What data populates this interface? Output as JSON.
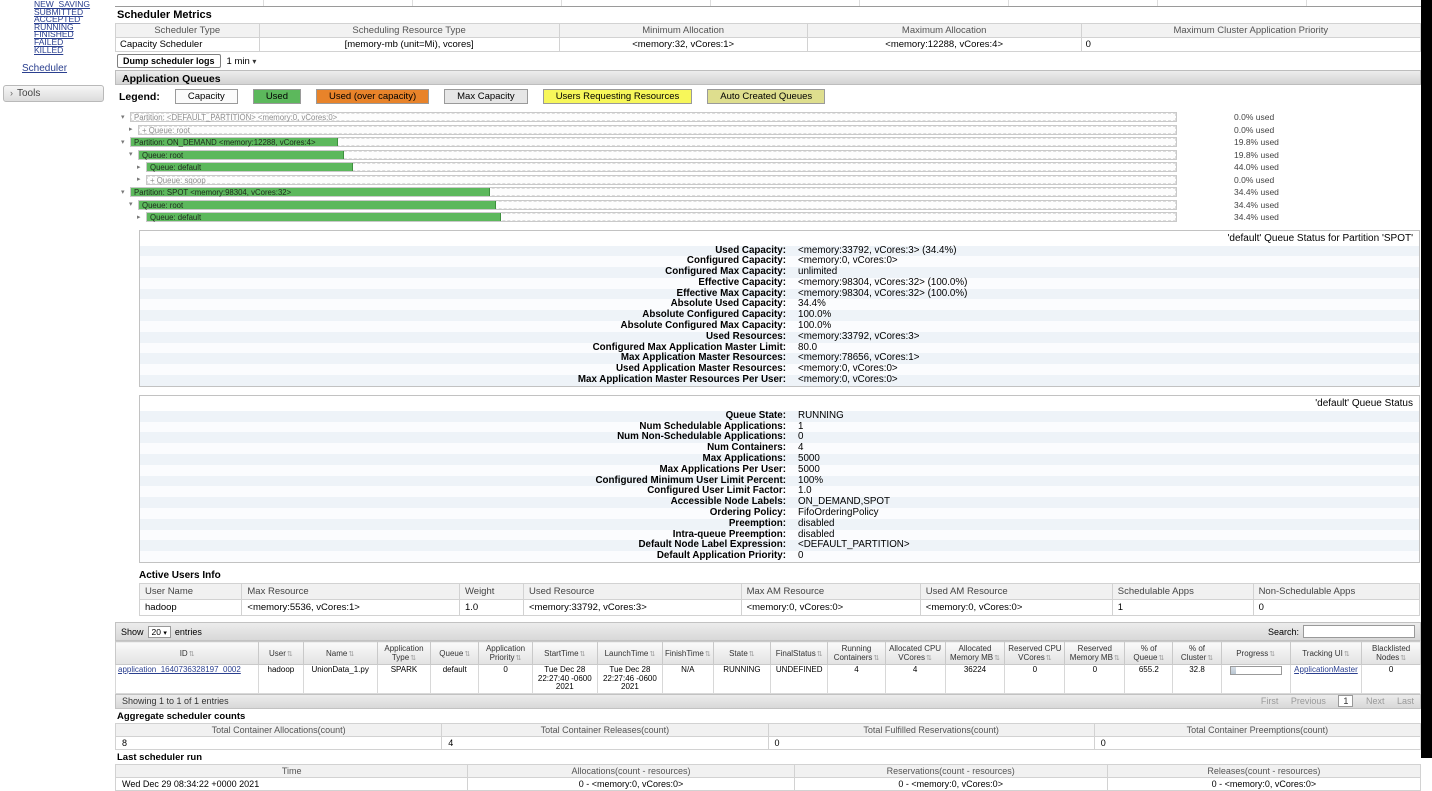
{
  "colors": {
    "used": "#5cb85c",
    "used_border": "#3e8f3e",
    "over_capacity": "#e8832a",
    "max_capacity": "#e6e6e6",
    "capacity": "#fbfbfb",
    "users_requesting": "#f7f75a",
    "auto_created": "#dede8e"
  },
  "sidebar": {
    "app_states": [
      "NEW_SAVING",
      "SUBMITTED",
      "ACCEPTED",
      "RUNNING",
      "FINISHED",
      "FAILED",
      "KILLED"
    ],
    "scheduler": "Scheduler",
    "tools": "Tools",
    "tools_chevron": "›"
  },
  "scheduler_metrics": {
    "title": "Scheduler Metrics",
    "headers": [
      "Scheduler Type",
      "Scheduling Resource Type",
      "Minimum Allocation",
      "Maximum Allocation",
      "Maximum Cluster Application Priority"
    ],
    "row": [
      "Capacity Scheduler",
      "[memory-mb (unit=Mi), vcores]",
      "<memory:32, vCores:1>",
      "<memory:12288, vCores:4>",
      "0"
    ]
  },
  "dump": {
    "button": "Dump scheduler logs",
    "interval": "1 min",
    "chevron": "▾"
  },
  "queues": {
    "title": "Application Queues",
    "legend_label": "Legend:",
    "legend": [
      {
        "label": "Capacity",
        "key": "capacity"
      },
      {
        "label": "Used",
        "key": "used"
      },
      {
        "label": "Used (over capacity)",
        "key": "over_capacity"
      },
      {
        "label": "Max Capacity",
        "key": "max_capacity"
      },
      {
        "label": "Users Requesting Resources",
        "key": "users_requesting"
      },
      {
        "label": "Auto Created Queues",
        "key": "auto_created"
      }
    ],
    "tree": [
      {
        "label": "Partition: <DEFAULT_PARTITION> <memory:0, vCores:0>",
        "pct_label": "0.0% used",
        "bar_pct": 0,
        "indent": 0,
        "expander": "▾"
      },
      {
        "label": "+ Queue: root",
        "pct_label": "0.0% used",
        "bar_pct": 0,
        "indent": 1,
        "expander": "▸"
      },
      {
        "label": "Partition: ON_DEMAND <memory:12288, vCores:4>",
        "pct_label": "19.8% used",
        "bar_pct": 19.8,
        "indent": 0,
        "expander": "▾"
      },
      {
        "label": "Queue: root",
        "pct_label": "19.8% used",
        "bar_pct": 19.8,
        "indent": 1,
        "expander": "▾"
      },
      {
        "label": "Queue: default",
        "pct_label": "44.0% used",
        "bar_pct": 20,
        "indent": 2,
        "expander": "▸"
      },
      {
        "label": "+ Queue: sqoop",
        "pct_label": "0.0% used",
        "bar_pct": 0,
        "indent": 2,
        "expander": "▸"
      },
      {
        "label": "Partition: SPOT <memory:98304, vCores:32>",
        "pct_label": "34.4% used",
        "bar_pct": 34.4,
        "indent": 0,
        "expander": "▾"
      },
      {
        "label": "Queue: root",
        "pct_label": "34.4% used",
        "bar_pct": 34.4,
        "indent": 1,
        "expander": "▾"
      },
      {
        "label": "Queue: default",
        "pct_label": "34.4% used",
        "bar_pct": 34.4,
        "indent": 2,
        "expander": "▸"
      }
    ]
  },
  "spot_panel": {
    "title": "'default' Queue Status for Partition 'SPOT'",
    "rows": [
      {
        "label": "Used Capacity:",
        "value": "<memory:33792, vCores:3> (34.4%)"
      },
      {
        "label": "Configured Capacity:",
        "value": "<memory:0, vCores:0>"
      },
      {
        "label": "Configured Max Capacity:",
        "value": "unlimited"
      },
      {
        "label": "Effective Capacity:",
        "value": "<memory:98304, vCores:32> (100.0%)"
      },
      {
        "label": "Effective Max Capacity:",
        "value": "<memory:98304, vCores:32> (100.0%)"
      },
      {
        "label": "Absolute Used Capacity:",
        "value": "34.4%"
      },
      {
        "label": "Absolute Configured Capacity:",
        "value": "100.0%"
      },
      {
        "label": "Absolute Configured Max Capacity:",
        "value": "100.0%"
      },
      {
        "label": "Used Resources:",
        "value": "<memory:33792, vCores:3>"
      },
      {
        "label": "Configured Max Application Master Limit:",
        "value": "80.0"
      },
      {
        "label": "Max Application Master Resources:",
        "value": "<memory:78656, vCores:1>"
      },
      {
        "label": "Used Application Master Resources:",
        "value": "<memory:0, vCores:0>"
      },
      {
        "label": "Max Application Master Resources Per User:",
        "value": "<memory:0, vCores:0>"
      }
    ]
  },
  "status_panel": {
    "title": "'default' Queue Status",
    "rows": [
      {
        "label": "Queue State:",
        "value": "RUNNING"
      },
      {
        "label": "Num Schedulable Applications:",
        "value": "1"
      },
      {
        "label": "Num Non-Schedulable Applications:",
        "value": "0"
      },
      {
        "label": "Num Containers:",
        "value": "4"
      },
      {
        "label": "Max Applications:",
        "value": "5000"
      },
      {
        "label": "Max Applications Per User:",
        "value": "5000"
      },
      {
        "label": "Configured Minimum User Limit Percent:",
        "value": "100%"
      },
      {
        "label": "Configured User Limit Factor:",
        "value": "1.0"
      },
      {
        "label": "Accessible Node Labels:",
        "value": "ON_DEMAND,SPOT"
      },
      {
        "label": "Ordering Policy:",
        "value": "FifoOrderingPolicy"
      },
      {
        "label": "Preemption:",
        "value": "disabled"
      },
      {
        "label": "Intra-queue Preemption:",
        "value": "disabled"
      },
      {
        "label": "Default Node Label Expression:",
        "value": "<DEFAULT_PARTITION>"
      },
      {
        "label": "Default Application Priority:",
        "value": "0"
      }
    ]
  },
  "active_users": {
    "title": "Active Users Info",
    "headers": [
      "User Name",
      "Max Resource",
      "Weight",
      "Used Resource",
      "Max AM Resource",
      "Used AM Resource",
      "Schedulable Apps",
      "Non-Schedulable Apps"
    ],
    "rows": [
      [
        "hadoop",
        "<memory:5536, vCores:1>",
        "1.0",
        "<memory:33792, vCores:3>",
        "<memory:0, vCores:0>",
        "<memory:0, vCores:0>",
        "1",
        "0"
      ]
    ]
  },
  "apps_table": {
    "show_label": "Show",
    "page_size": "20",
    "entries_label": "entries",
    "search_label": "Search:",
    "sort_icon": "⇅",
    "headers": [
      "ID",
      "User",
      "Name",
      "Application Type",
      "Queue",
      "Application Priority",
      "StartTime",
      "LaunchTime",
      "FinishTime",
      "State",
      "FinalStatus",
      "Running Containers",
      "Allocated CPU VCores",
      "Allocated Memory MB",
      "Reserved CPU VCores",
      "Reserved Memory MB",
      "% of Queue",
      "% of Cluster",
      "Progress",
      "Tracking UI",
      "Blacklisted Nodes"
    ],
    "row": [
      "application_1640736328197_0002",
      "hadoop",
      "UnionData_1.py",
      "SPARK",
      "default",
      "0",
      "Tue Dec 28 22:27:40 -0600 2021",
      "Tue Dec 28 22:27:46 -0600 2021",
      "N/A",
      "RUNNING",
      "UNDEFINED",
      "4",
      "4",
      "36224",
      "0",
      "0",
      "655.2",
      "32.8",
      "",
      "ApplicationMaster",
      "0"
    ],
    "progress_pct": 10,
    "footer": "Showing 1 to 1 of 1 entries",
    "pagination": {
      "first": "First",
      "previous": "Previous",
      "page": "1",
      "next": "Next",
      "last": "Last"
    }
  },
  "aggregate": {
    "title": "Aggregate scheduler counts",
    "headers": [
      "Total Container Allocations(count)",
      "Total Container Releases(count)",
      "Total Fulfilled Reservations(count)",
      "Total Container Preemptions(count)"
    ],
    "values": [
      "8",
      "4",
      "0",
      "0"
    ]
  },
  "last_run": {
    "title": "Last scheduler run",
    "headers": [
      "Time",
      "Allocations(count - resources)",
      "Reservations(count - resources)",
      "Releases(count - resources)"
    ],
    "row": [
      "Wed Dec 29 08:34:22 +0000 2021",
      "0 - <memory:0, vCores:0>",
      "0 - <memory:0, vCores:0>",
      "0 - <memory:0, vCores:0>"
    ]
  }
}
